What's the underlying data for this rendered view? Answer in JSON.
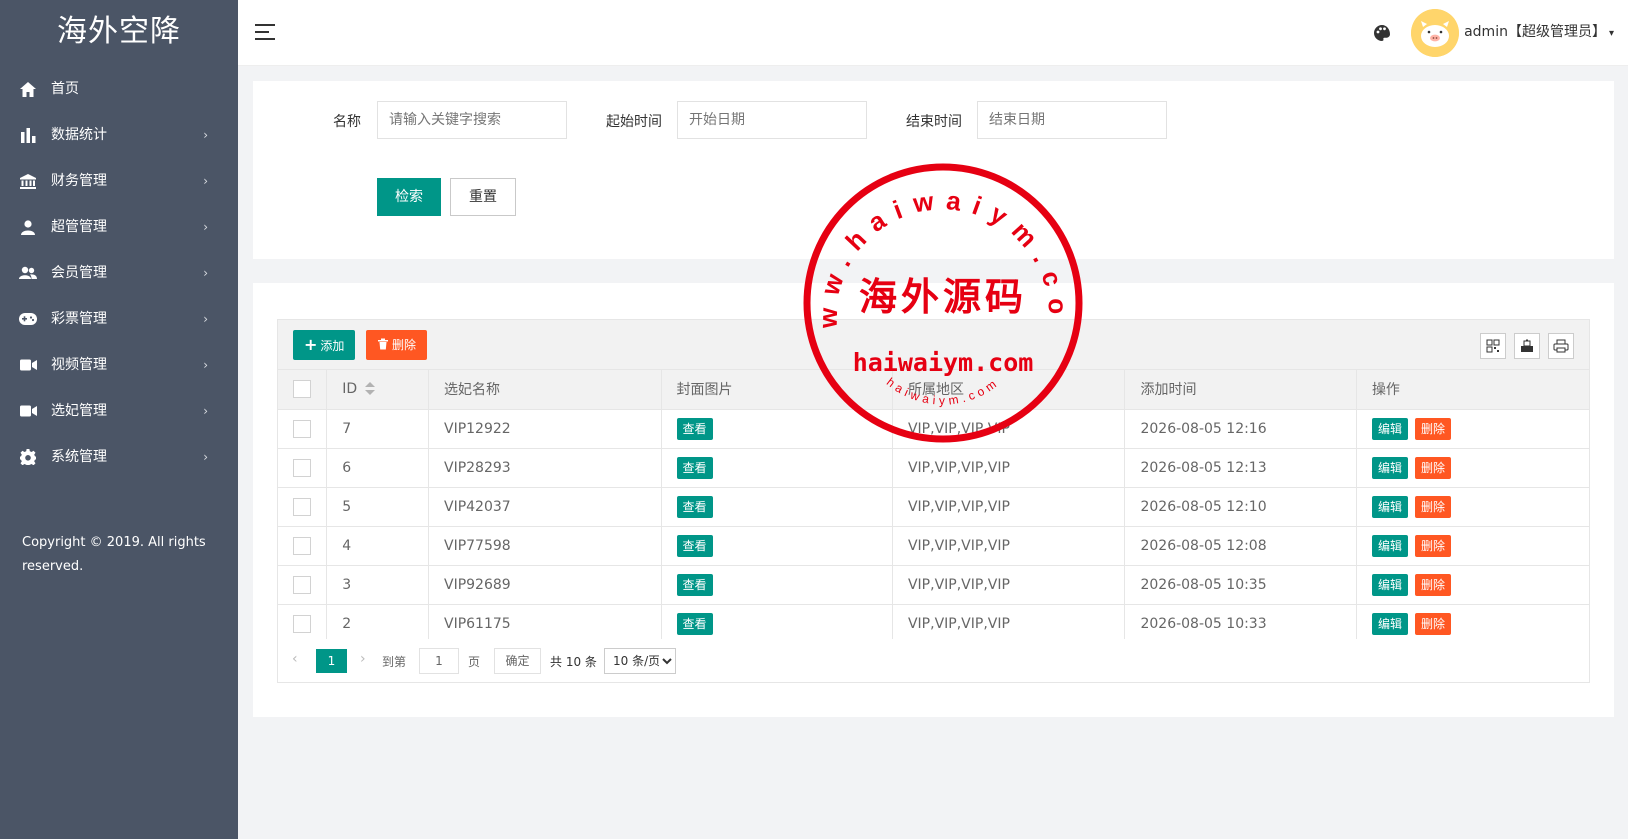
{
  "app": {
    "logo": "海外空降"
  },
  "sidebar": {
    "items": [
      {
        "label": "首页",
        "icon": "home-icon",
        "has_arrow": false
      },
      {
        "label": "数据统计",
        "icon": "bar-chart-icon",
        "has_arrow": true
      },
      {
        "label": "财务管理",
        "icon": "bank-icon",
        "has_arrow": true
      },
      {
        "label": "超管管理",
        "icon": "user-icon",
        "has_arrow": true
      },
      {
        "label": "会员管理",
        "icon": "users-icon",
        "has_arrow": true
      },
      {
        "label": "彩票管理",
        "icon": "gamepad-icon",
        "has_arrow": true
      },
      {
        "label": "视频管理",
        "icon": "video-icon",
        "has_arrow": true
      },
      {
        "label": "选妃管理",
        "icon": "video-icon",
        "has_arrow": true
      },
      {
        "label": "系统管理",
        "icon": "gear-icon",
        "has_arrow": true
      }
    ],
    "arrow": "›",
    "copyright": "Copyright © 2019. All rights reserved."
  },
  "header": {
    "user": "admin【超级管理员】",
    "caret": "▾"
  },
  "search": {
    "name_label": "名称",
    "name_placeholder": "请输入关键字搜索",
    "start_label": "起始时间",
    "start_placeholder": "开始日期",
    "end_label": "结束时间",
    "end_placeholder": "结束日期",
    "search_btn": "检索",
    "reset_btn": "重置"
  },
  "toolbar": {
    "add_icon": "+",
    "add_label": "添加",
    "delete_label": "删除"
  },
  "table": {
    "columns": [
      "ID",
      "选妃名称",
      "封面图片",
      "所属地区",
      "添加时间",
      "操作"
    ],
    "view_label": "查看",
    "edit_label": "编辑",
    "delete_label": "删除",
    "rows": [
      {
        "id": "7",
        "name": "VIP12922",
        "region": "VIP,VIP,VIP,VIP",
        "time": "2026-08-05 12:16"
      },
      {
        "id": "6",
        "name": "VIP28293",
        "region": "VIP,VIP,VIP,VIP",
        "time": "2026-08-05 12:13"
      },
      {
        "id": "5",
        "name": "VIP42037",
        "region": "VIP,VIP,VIP,VIP",
        "time": "2026-08-05 12:10"
      },
      {
        "id": "4",
        "name": "VIP77598",
        "region": "VIP,VIP,VIP,VIP",
        "time": "2026-08-05 12:08"
      },
      {
        "id": "3",
        "name": "VIP92689",
        "region": "VIP,VIP,VIP,VIP",
        "time": "2026-08-05 10:35"
      },
      {
        "id": "2",
        "name": "VIP61175",
        "region": "VIP,VIP,VIP,VIP",
        "time": "2026-08-05 10:33"
      }
    ]
  },
  "pager": {
    "prev": "‹",
    "next": "›",
    "current": "1",
    "goto_label": "到第",
    "goto_value": "1",
    "page_unit": "页",
    "confirm": "确定",
    "total": "共 10 条",
    "page_size": "10 条/页"
  },
  "watermark": {
    "top_arc": "www.haiwaiym.com",
    "center": "海外源码",
    "domain": "haiwaiym.com",
    "bottom_arc": "haiwaiym.com",
    "color": "#e60012"
  }
}
